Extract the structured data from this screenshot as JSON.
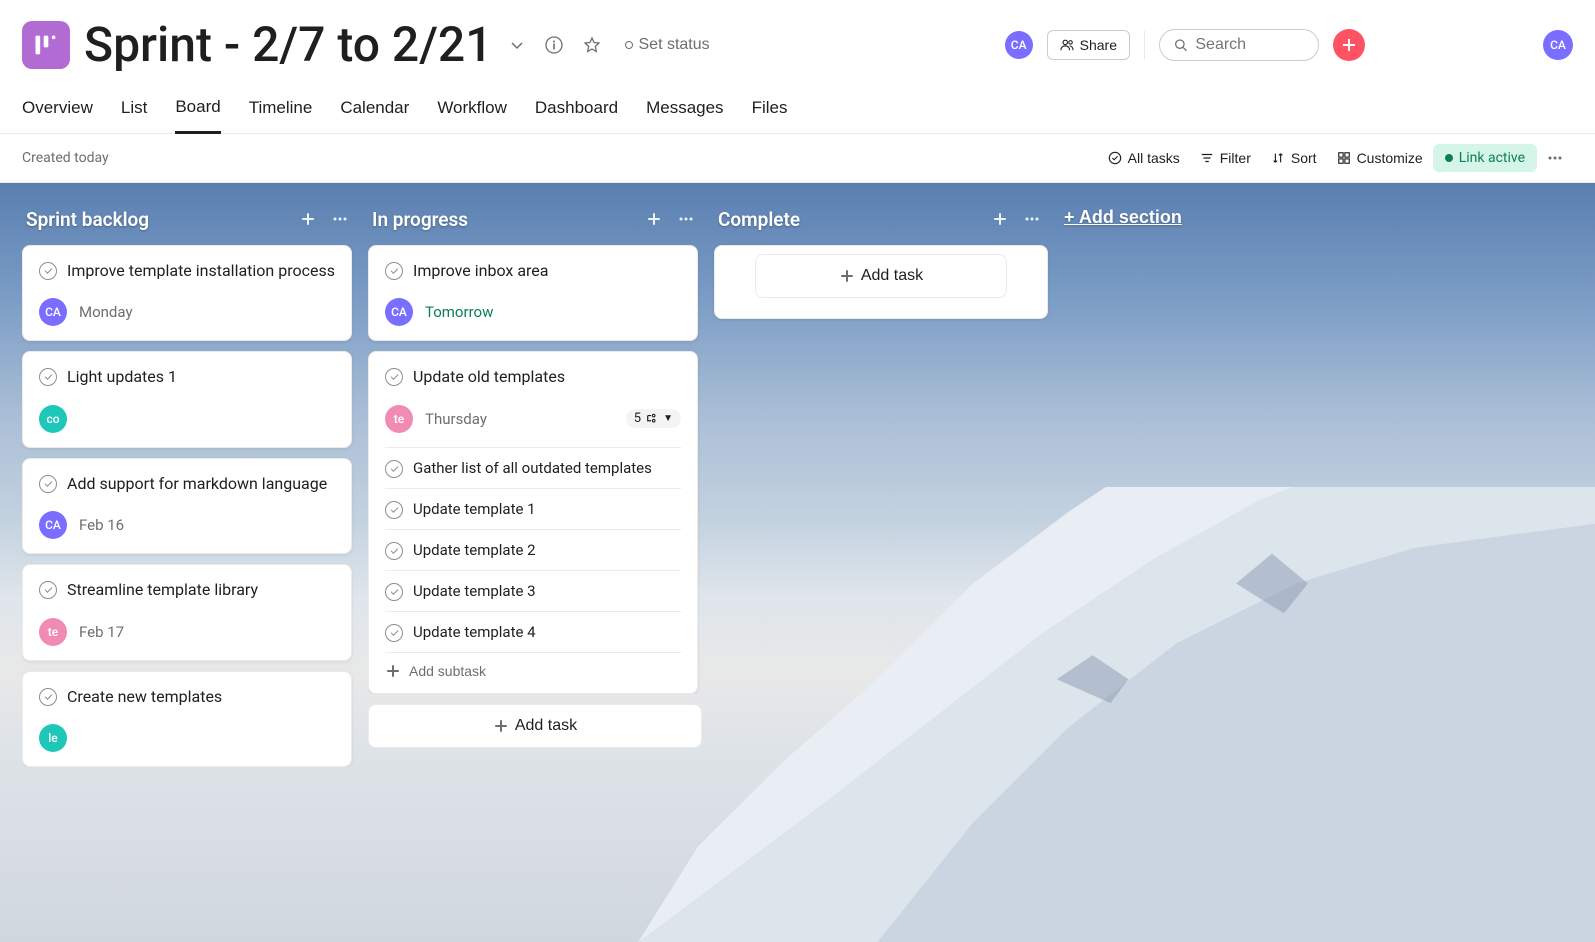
{
  "header": {
    "title": "Sprint - 2/7 to 2/21",
    "set_status": "Set status",
    "share": "Share",
    "search_placeholder": "Search",
    "user_initials": "CA"
  },
  "tabs": [
    "Overview",
    "List",
    "Board",
    "Timeline",
    "Calendar",
    "Workflow",
    "Dashboard",
    "Messages",
    "Files"
  ],
  "active_tab": "Board",
  "toolbar": {
    "created": "Created today",
    "all_tasks": "All tasks",
    "filter": "Filter",
    "sort": "Sort",
    "customize": "Customize",
    "link_active": "Link active"
  },
  "columns": [
    {
      "title": "Sprint backlog",
      "cards": [
        {
          "title": "Improve template installation process",
          "assignee": "CA",
          "assignee_class": "ca",
          "due": "Monday"
        },
        {
          "title": "Light updates 1",
          "assignee": "co",
          "assignee_class": "co"
        },
        {
          "title": "Add support for markdown language",
          "assignee": "CA",
          "assignee_class": "ca",
          "due": "Feb 16"
        },
        {
          "title": "Streamline template library",
          "assignee": "te",
          "assignee_class": "te",
          "due": "Feb 17"
        },
        {
          "title": "Create new templates",
          "assignee": "le",
          "assignee_class": "le"
        }
      ]
    },
    {
      "title": "In progress",
      "cards": [
        {
          "title": "Improve inbox area",
          "assignee": "CA",
          "assignee_class": "ca",
          "due": "Tomorrow",
          "due_green": true
        },
        {
          "title": "Update old templates",
          "assignee": "te",
          "assignee_class": "te",
          "due": "Thursday",
          "subtask_count": "5",
          "subtasks": [
            "Gather list of all outdated templates",
            "Update template 1",
            "Update template 2",
            "Update template 3",
            "Update template 4"
          ],
          "add_subtask": "Add subtask"
        }
      ],
      "add_task": "Add task"
    },
    {
      "title": "Complete",
      "add_task": "Add task"
    }
  ],
  "add_section": "+ Add section"
}
